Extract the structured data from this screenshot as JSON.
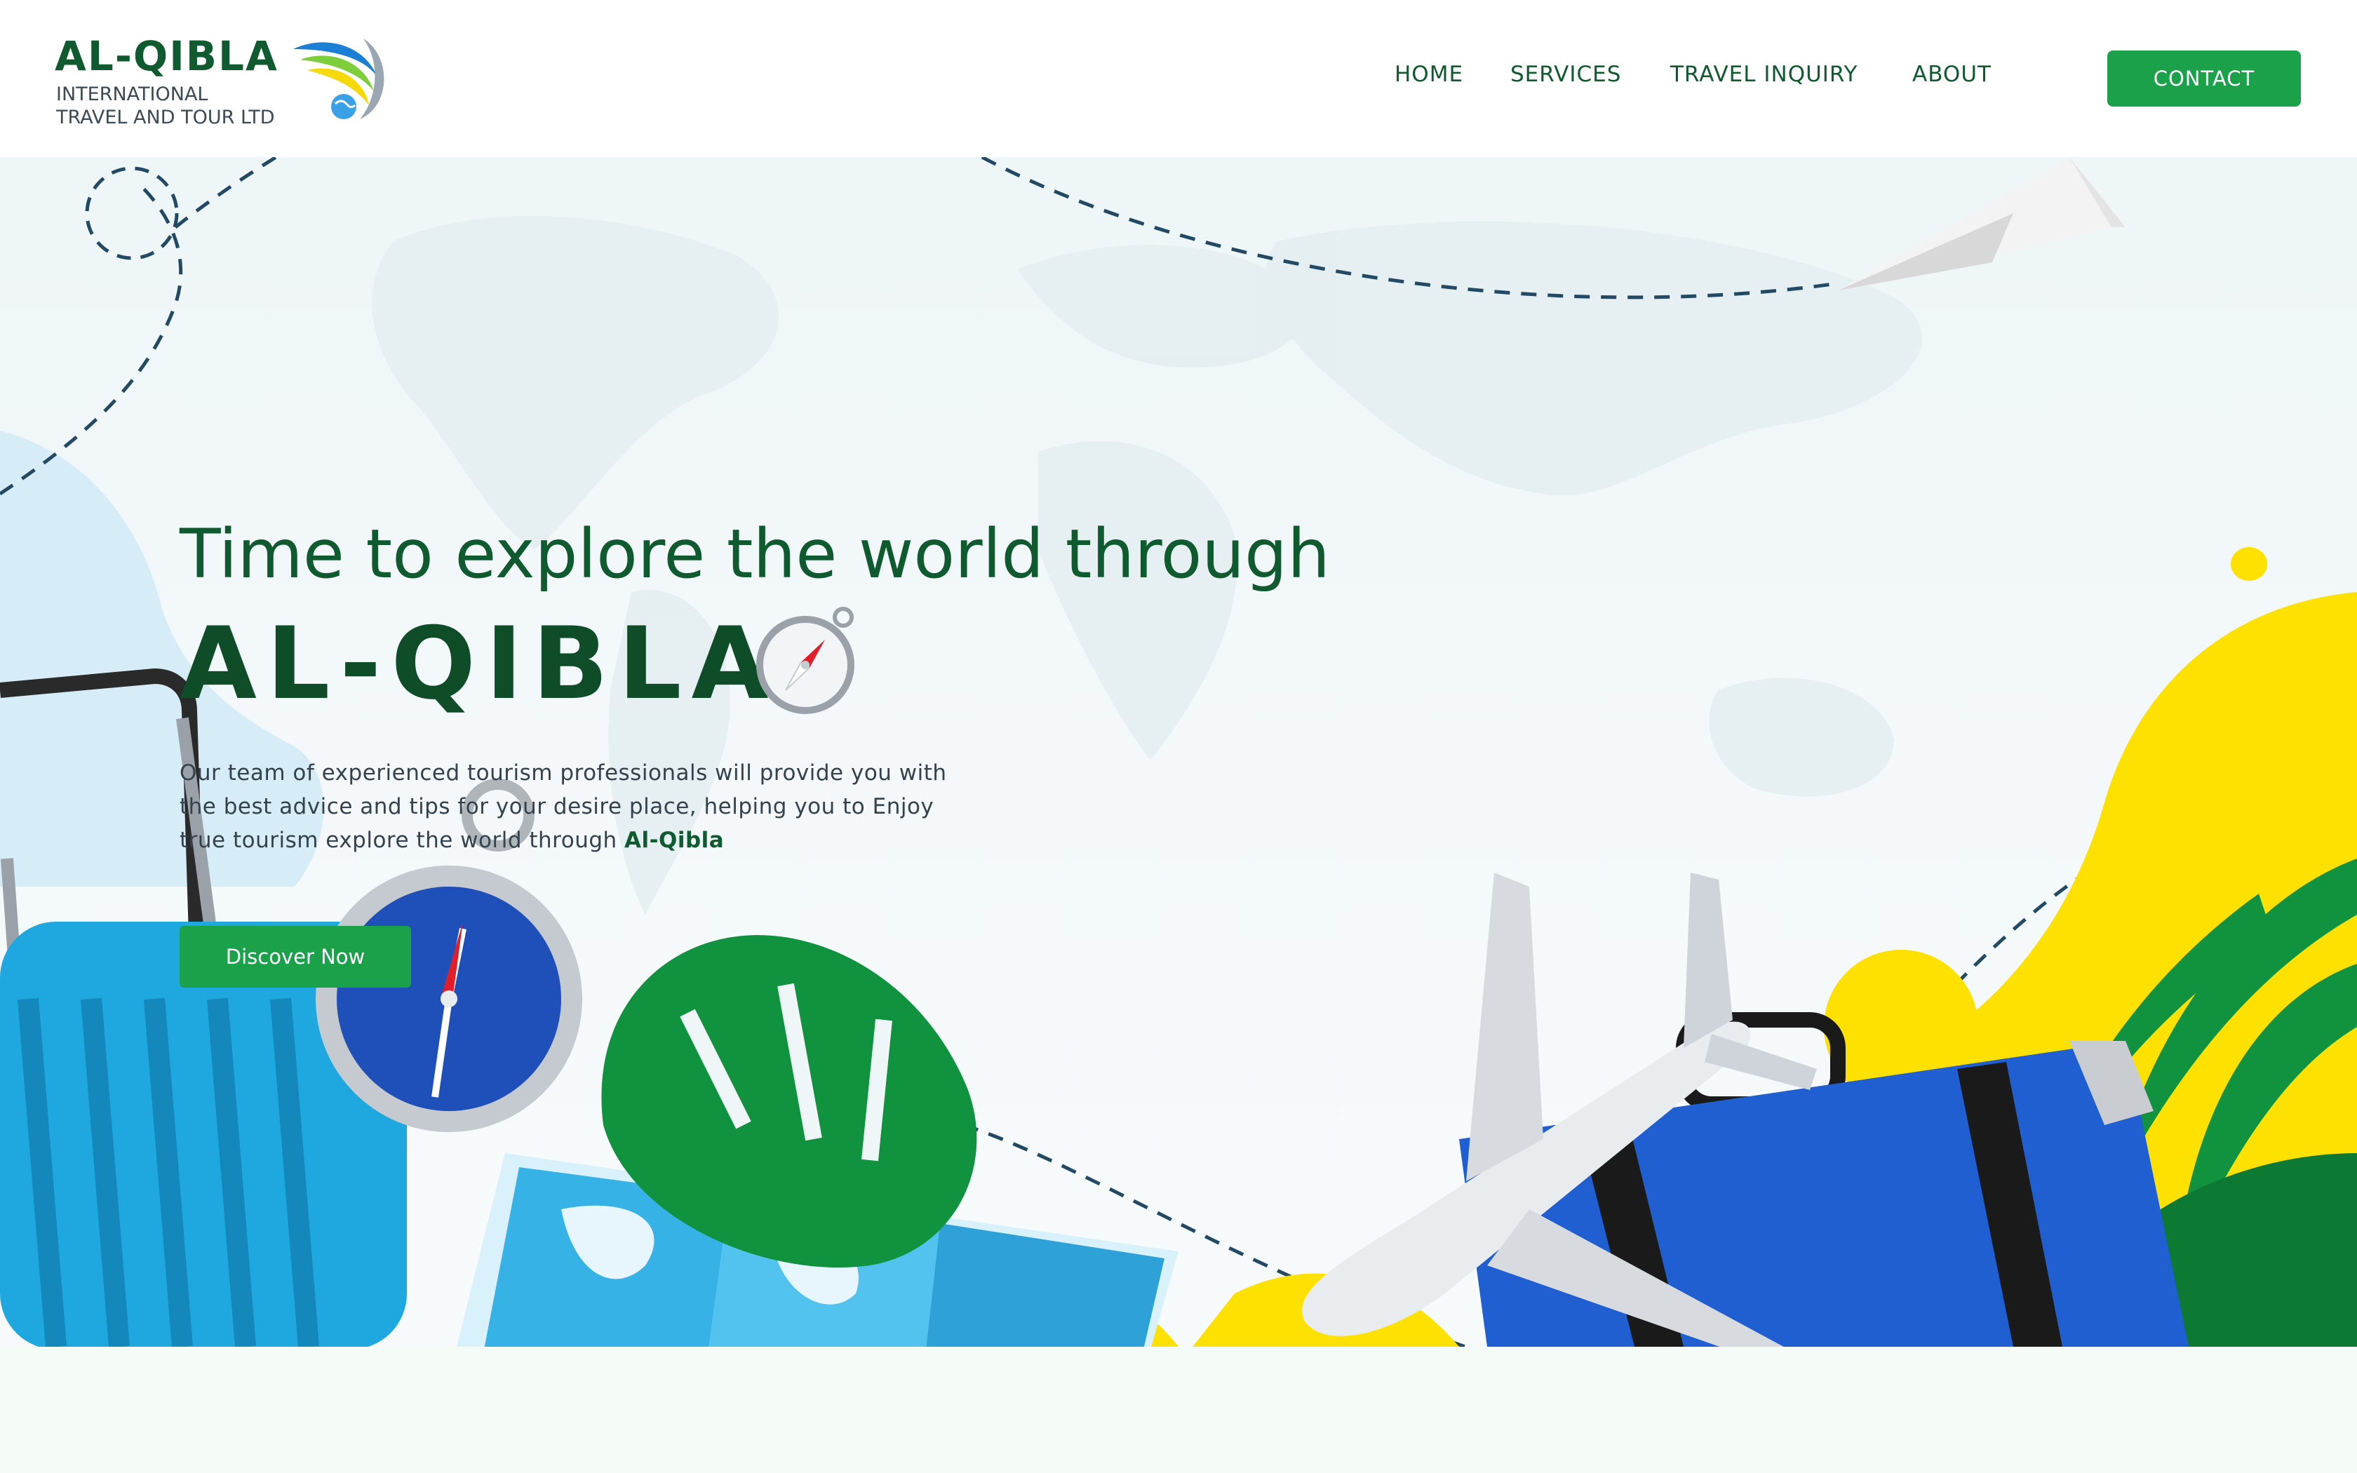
{
  "header": {
    "brand_name": "AL-QIBLA",
    "brand_sub_line1": "INTERNATIONAL",
    "brand_sub_line2": "TRAVEL AND TOUR LTD",
    "nav": [
      {
        "label": "HOME"
      },
      {
        "label": "SERVICES"
      },
      {
        "label": "TRAVEL INQUIRY"
      },
      {
        "label": "ABOUT"
      }
    ],
    "contact_label": "CONTACT"
  },
  "hero": {
    "headline": "Time to explore the world through",
    "brand_big": "AL-QIBLA",
    "desc_line1": "Our team of experienced tourism professionals will provide you with",
    "desc_line2": "the best advice and tips for your desire place, helping you to Enjoy",
    "desc_line3_prefix": "true tourism explore the world through ",
    "desc_highlight": "Al-Qibla",
    "cta_label": "Discover Now"
  },
  "colors": {
    "brand_green": "#0f5a2e",
    "button_green": "#1aa14a",
    "accent_yellow": "#ffe100",
    "accent_blue": "#1f5fd1",
    "luggage_blue": "#1fa7df"
  },
  "icons": [
    "brand-logo-icon",
    "compass-icon",
    "paper-plane-icon",
    "airplane-icon",
    "suitcase-icon",
    "map-icon",
    "leaf-icon"
  ]
}
